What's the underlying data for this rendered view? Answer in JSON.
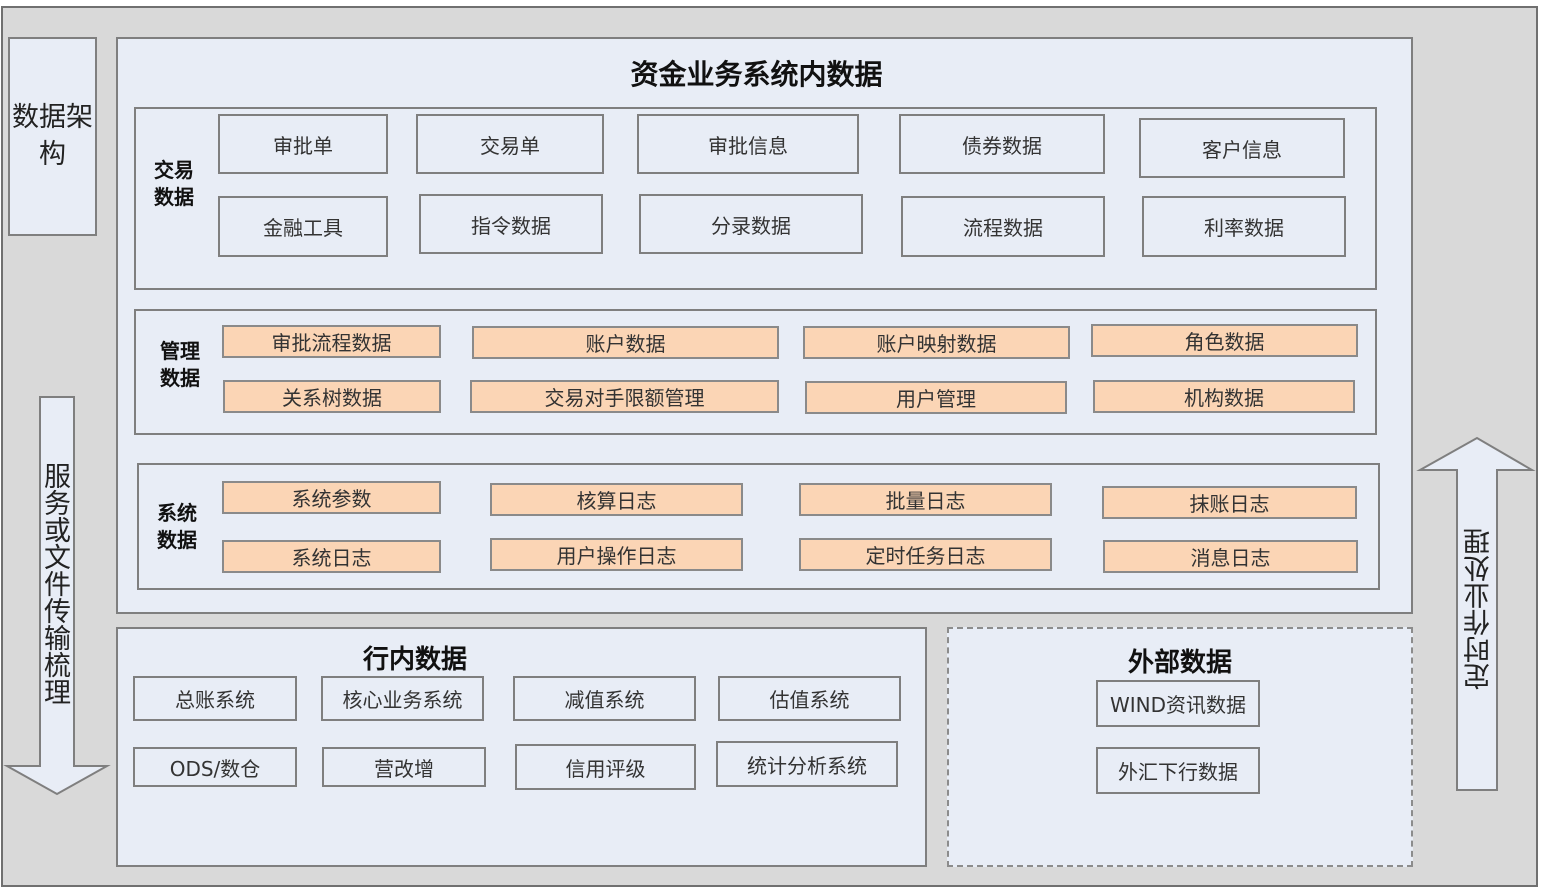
{
  "side_label": "数据架构",
  "left_arrow_label": "服务或文件传输梳理",
  "right_arrow_label": "定时作业处理",
  "main": {
    "title": "资金业务系统内数据",
    "groups": [
      {
        "label_lines": [
          "交易",
          "数据"
        ],
        "rows": [
          [
            "审批单",
            "交易单",
            "审批信息",
            "债券数据",
            "客户信息"
          ],
          [
            "金融工具",
            "指令数据",
            "分录数据",
            "流程数据",
            "利率数据"
          ]
        ]
      },
      {
        "label_lines": [
          "管理",
          "数据"
        ],
        "rows": [
          [
            "审批流程数据",
            "账户数据",
            "账户映射数据",
            "角色数据"
          ],
          [
            "关系树数据",
            "交易对手限额管理",
            "用户管理",
            "机构数据"
          ]
        ]
      },
      {
        "label_lines": [
          "系统",
          "数据"
        ],
        "rows": [
          [
            "系统参数",
            "核算日志",
            "批量日志",
            "抹账日志"
          ],
          [
            "系统日志",
            "用户操作日志",
            "定时任务日志",
            "消息日志"
          ]
        ]
      }
    ]
  },
  "internal": {
    "title": "行内数据",
    "rows": [
      [
        "总账系统",
        "核心业务系统",
        "减值系统",
        "估值系统"
      ],
      [
        "ODS/数仓",
        "营改增",
        "信用评级",
        "统计分析系统"
      ]
    ]
  },
  "external": {
    "title": "外部数据",
    "items": [
      "WIND资讯数据",
      "外汇下行数据"
    ]
  },
  "colors": {
    "background": "#d9d9d9",
    "panel": "#e8edf6",
    "orange_box": "#fbd5b5",
    "border": "#7f7f7f"
  }
}
